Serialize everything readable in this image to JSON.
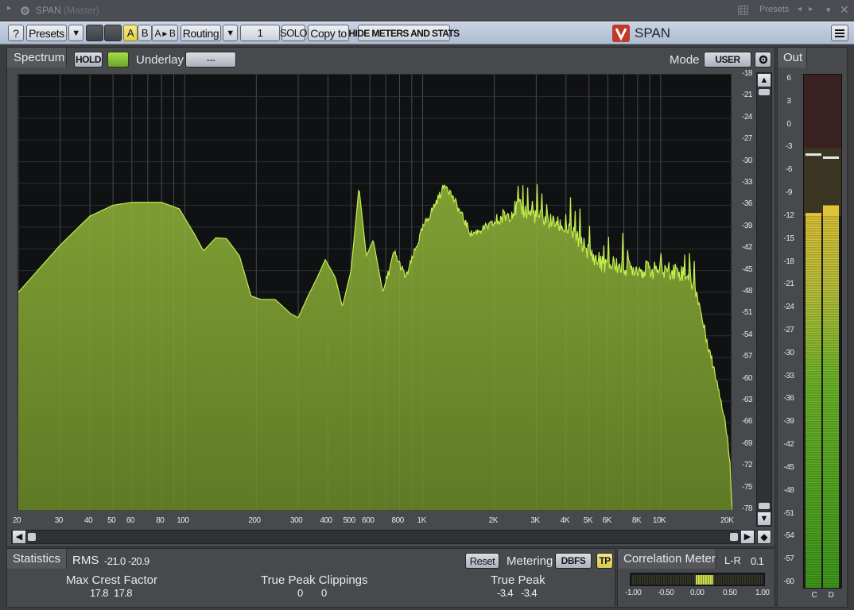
{
  "window": {
    "title": "SPAN",
    "subtitle": "(Master)",
    "presets_label": "Presets"
  },
  "toolbar": {
    "help": "?",
    "presets": "Presets",
    "a": "A",
    "b": "B",
    "a_to_b": "A ▸ B",
    "routing": "Routing",
    "channel": "1",
    "solo": "SOLO",
    "copy_to": "Copy to",
    "hide_meters": "HIDE METERS AND STATS",
    "logo": "SPAN"
  },
  "spectrum": {
    "title": "Spectrum",
    "hold": "HOLD",
    "underlay_label": "Underlay",
    "underlay_value": "---",
    "mode_label": "Mode",
    "mode_value": "USER",
    "freq_labels": [
      "20",
      "30",
      "40",
      "50",
      "60",
      "80",
      "100",
      "200",
      "300",
      "400",
      "500",
      "600",
      "800",
      "1K",
      "2K",
      "3K",
      "4K",
      "5K",
      "6K",
      "8K",
      "10K",
      "20K"
    ],
    "db_labels": [
      "-18",
      "-21",
      "-24",
      "-27",
      "-30",
      "-33",
      "-36",
      "-39",
      "-42",
      "-45",
      "-48",
      "-51",
      "-54",
      "-57",
      "-60",
      "-63",
      "-66",
      "-69",
      "-72",
      "-75",
      "-78"
    ]
  },
  "out": {
    "title": "Out",
    "scale": [
      "6",
      "3",
      "0",
      "-3",
      "-6",
      "-9",
      "-12",
      "-15",
      "-18",
      "-21",
      "-24",
      "-27",
      "-30",
      "-33",
      "-36",
      "-39",
      "-42",
      "-45",
      "-48",
      "-51",
      "-54",
      "-57",
      "-60"
    ],
    "channels": [
      "C",
      "D"
    ]
  },
  "statistics": {
    "title": "Statistics",
    "rms_label": "RMS",
    "rms_l": "-21.0",
    "rms_r": "-20.9",
    "reset": "Reset",
    "metering_label": "Metering",
    "metering_value": "DBFS",
    "tp": "TP",
    "crest_label": "Max Crest Factor",
    "crest_l": "17.8",
    "crest_r": "17.8",
    "clip_label": "True Peak Clippings",
    "clip_l": "0",
    "clip_r": "0",
    "tp_label": "True Peak",
    "tp_l": "-3.4",
    "tp_r": "-3.4"
  },
  "correlation": {
    "title": "Correlation Meter",
    "mode": "L-R",
    "value": "0.1",
    "scale": [
      "-1.00",
      "-0.50",
      "0.00",
      "0.50",
      "1.00"
    ]
  },
  "colors": {
    "spectrum_fill": "#6f8f2a",
    "spectrum_line": "#c8f050",
    "accent_yellow": "#e8d85a",
    "meter_green": "#5fb52b"
  }
}
